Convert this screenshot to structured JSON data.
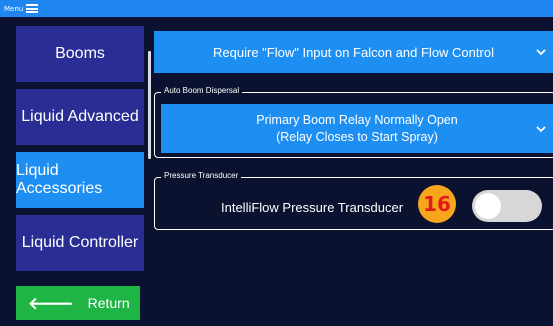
{
  "topbar": {
    "menu_label": "Menu"
  },
  "sidebar": {
    "items": [
      {
        "label": "Booms",
        "active": false
      },
      {
        "label": "Liquid Advanced",
        "active": false
      },
      {
        "label": "Liquid Accessories",
        "active": true
      },
      {
        "label": "Liquid Controller",
        "active": false
      }
    ],
    "return_label": "Return"
  },
  "content": {
    "flow_dropdown": {
      "value": "Require \"Flow\" Input on Falcon and Flow Control"
    },
    "auto_boom": {
      "legend": "Auto Boom Dispersal",
      "line1": "Primary Boom Relay Normally Open",
      "line2": "(Relay Closes to Start Spray)"
    },
    "pressure": {
      "legend": "Pressure Transducer",
      "label": "IntelliFlow Pressure Transducer",
      "badge": "16",
      "toggle_on": false
    }
  },
  "colors": {
    "background": "#0b1230",
    "topbar": "#1f86f0",
    "nav_button": "#2a2e94",
    "nav_active": "#1e8ff2",
    "dropdown": "#1e8ff2",
    "return_button": "#1fb545",
    "badge": "#f7a51c",
    "badge_text": "#e01b1b"
  },
  "icons": [
    "hamburger-icon",
    "arrow-left-icon",
    "chevron-down-icon"
  ]
}
